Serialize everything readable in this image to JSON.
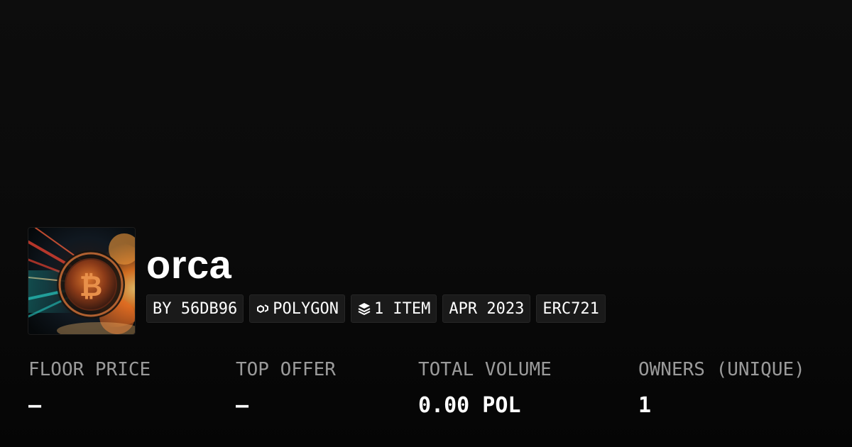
{
  "collection": {
    "name": "orca",
    "tags": [
      {
        "icon": "none",
        "label": "BY 56DB96"
      },
      {
        "icon": "polygon-chain-icon",
        "label": "POLYGON"
      },
      {
        "icon": "layers-icon",
        "label": "1 ITEM"
      },
      {
        "icon": "none",
        "label": "APR 2023"
      },
      {
        "icon": "none",
        "label": "ERC721"
      }
    ]
  },
  "stats": [
    {
      "label": "FLOOR PRICE",
      "value": "–"
    },
    {
      "label": "TOP OFFER",
      "value": "–"
    },
    {
      "label": "TOTAL VOLUME",
      "value": "0.00 POL"
    },
    {
      "label": "OWNERS (UNIQUE)",
      "value": "1"
    }
  ],
  "colors": {
    "background": "#0a0a0a",
    "tag_background": "#1a1a1a",
    "label_gray": "#9a9a9a",
    "text": "#ffffff"
  }
}
